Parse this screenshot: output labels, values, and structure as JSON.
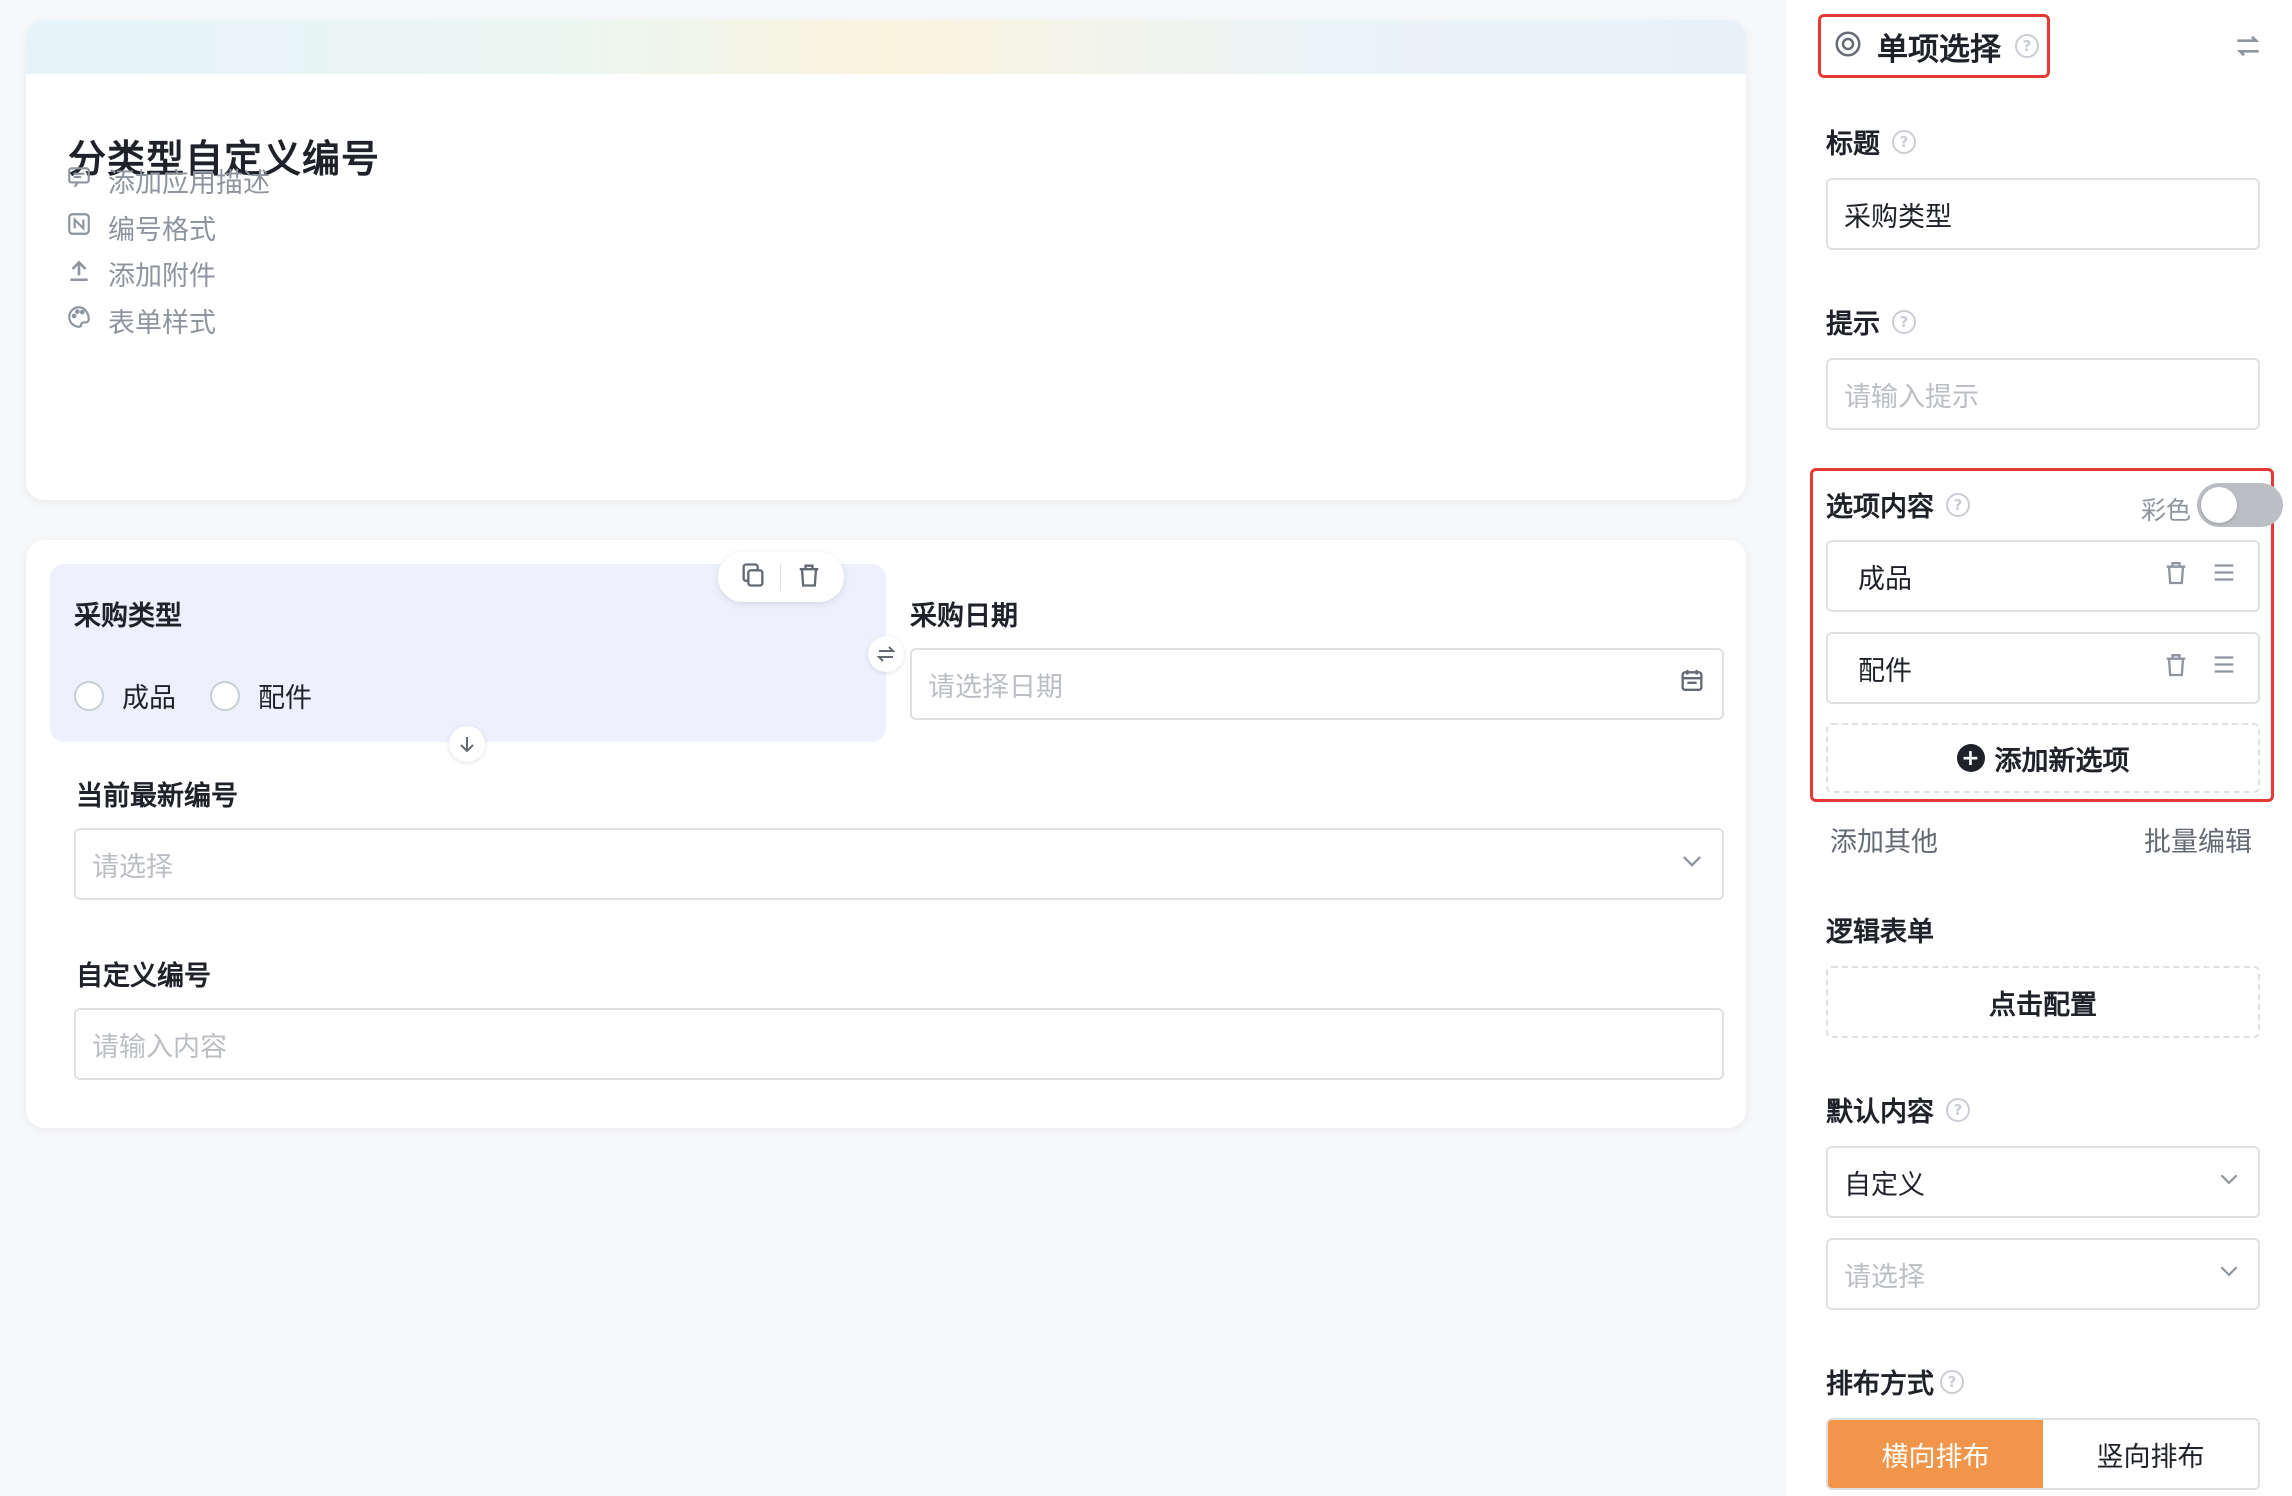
{
  "app": {
    "title": "分类型自定义编号",
    "meta_items": [
      {
        "label": "添加应用描述",
        "icon": "comment-icon"
      },
      {
        "label": "编号格式",
        "icon": "number-format-icon"
      },
      {
        "label": "添加附件",
        "icon": "upload-icon"
      },
      {
        "label": "表单样式",
        "icon": "palette-icon"
      }
    ]
  },
  "form": {
    "purchase_type": {
      "label": "采购类型",
      "options": [
        "成品",
        "配件"
      ]
    },
    "purchase_date": {
      "label": "采购日期",
      "placeholder": "请选择日期"
    },
    "latest_number": {
      "label": "当前最新编号",
      "placeholder": "请选择"
    },
    "custom_number": {
      "label": "自定义编号",
      "placeholder": "请输入内容"
    }
  },
  "panel": {
    "header_title": "单项选择",
    "title_label": "标题",
    "title_value": "采购类型",
    "hint_label": "提示",
    "hint_placeholder": "请输入提示",
    "options_label": "选项内容",
    "color_label": "彩色",
    "options": [
      "成品",
      "配件"
    ],
    "add_option_label": "添加新选项",
    "add_other_label": "添加其他",
    "batch_edit_label": "批量编辑",
    "logic_label": "逻辑表单",
    "logic_button": "点击配置",
    "default_label": "默认内容",
    "default_value": "自定义",
    "default_placeholder": "请选择",
    "layout_label": "排布方式",
    "layout_options": [
      "横向排布",
      "竖向排布"
    ],
    "layout_selected": "横向排布"
  },
  "colors": {
    "accent_orange": "#f0954a",
    "highlight_red": "#e53935",
    "selected_field_bg": "#eef1fd"
  }
}
